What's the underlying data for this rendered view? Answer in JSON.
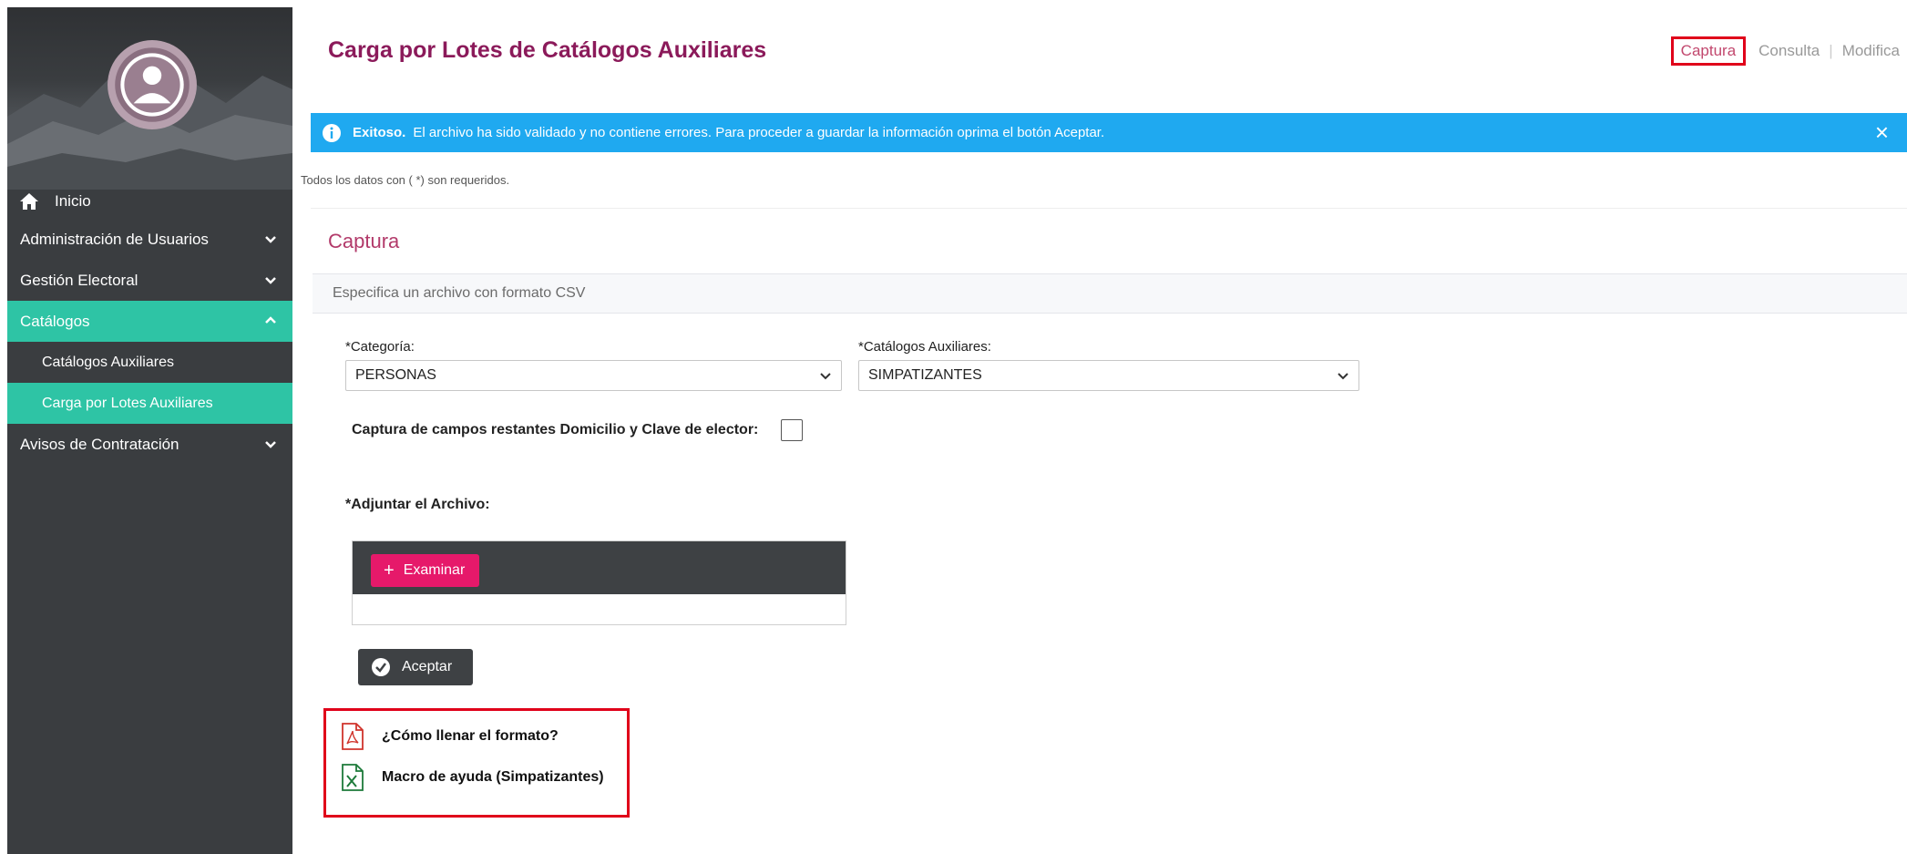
{
  "sidebar": {
    "items": [
      {
        "label": "Inicio"
      },
      {
        "label": "Administración de Usuarios"
      },
      {
        "label": "Gestión Electoral"
      },
      {
        "label": "Catálogos"
      },
      {
        "label": "Catálogos Auxiliares"
      },
      {
        "label": "Carga por Lotes Auxiliares"
      },
      {
        "label": "Avisos de Contratación"
      }
    ]
  },
  "header": {
    "title": "Carga por Lotes de Catálogos Auxiliares",
    "links": [
      "Captura",
      "Consulta",
      "Modifica"
    ],
    "separator": "|"
  },
  "alert": {
    "strong": "Exitoso.",
    "message": "El archivo ha sido validado y no contiene errores. Para proceder a guardar la información oprima el botón Aceptar.",
    "close": "×"
  },
  "required_note": "Todos los datos con ( *) son requeridos.",
  "section": {
    "title": "Captura",
    "subtitle": "Especifica un archivo con formato CSV"
  },
  "form": {
    "categoria_label": "*Categoría:",
    "categoria_value": "PERSONAS",
    "catalogos_label": "*Catálogos Auxiliares:",
    "catalogos_value": "SIMPATIZANTES",
    "checkbox_label": "Captura de campos restantes Domicilio y Clave de elector:",
    "attach_label": "*Adjuntar el Archivo:",
    "browse_label": "Examinar",
    "browse_plus": "+",
    "accept_label": "Aceptar"
  },
  "help": {
    "pdf_label": "¿Cómo llenar el formato?",
    "xls_label": "Macro de ayuda (Simpatizantes)"
  },
  "colors": {
    "sidebar_bg": "#3a3d40",
    "accent_teal": "#2ec4a5",
    "title_color": "#8b1a5a",
    "alert_blue": "#1fa9f0",
    "browse_pink": "#e6196a",
    "highlight_red": "#e0001a"
  }
}
